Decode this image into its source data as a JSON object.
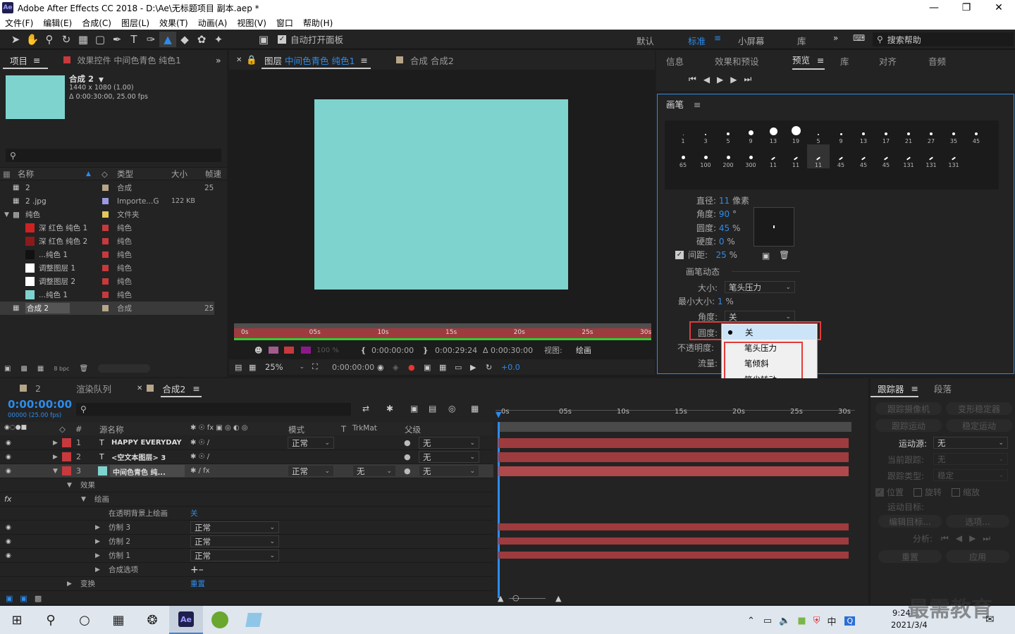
{
  "window": {
    "title": "Adobe After Effects CC 2018 - D:\\Ae\\无标题项目 副本.aep *",
    "app_badge": "Ae"
  },
  "menu": [
    "文件(F)",
    "编辑(E)",
    "合成(C)",
    "图层(L)",
    "效果(T)",
    "动画(A)",
    "视图(V)",
    "窗口",
    "帮助(H)"
  ],
  "toolbar": {
    "auto_open_label": "自动打开面板",
    "workspaces": [
      "默认",
      "标准",
      "小屏幕",
      "库"
    ],
    "active_workspace": "标准",
    "search_placeholder": "搜索帮助"
  },
  "project": {
    "tab_project": "项目",
    "tab_effects": "效果控件 中间色青色 纯色1",
    "comp_name": "合成 2",
    "comp_res": "1440 x 1080 (1.00)",
    "comp_dur": "Δ 0:00:30:00, 25.00 fps",
    "thumb_color": "#7fd3ce",
    "columns": [
      "名称",
      "类型",
      "大小",
      "帧速"
    ],
    "items": [
      {
        "name": "2",
        "color": "#b7a589",
        "type": "合成",
        "size": "",
        "fps": "25"
      },
      {
        "name": "2 .jpg",
        "color": "#9a9ae0",
        "type": "Importe...G",
        "size": "122 KB",
        "fps": ""
      },
      {
        "name": "纯色",
        "color": "#e4c55d",
        "type": "文件夹",
        "size": "",
        "fps": ""
      },
      {
        "name": "深 红色 纯色 1",
        "color": "#c8393d",
        "type": "纯色",
        "size": "",
        "fps": "",
        "swatch": "#cc2222"
      },
      {
        "name": "深 红色 纯色 2",
        "color": "#c8393d",
        "type": "纯色",
        "size": "",
        "fps": "",
        "swatch": "#8b1a1a"
      },
      {
        "name": "...纯色 1",
        "color": "#c8393d",
        "type": "纯色",
        "size": "",
        "fps": "",
        "swatch": "#111111"
      },
      {
        "name": "调整图层 1",
        "color": "#c8393d",
        "type": "纯色",
        "size": "",
        "fps": "",
        "swatch": "#ffffff"
      },
      {
        "name": "调整图层 2",
        "color": "#c8393d",
        "type": "纯色",
        "size": "",
        "fps": "",
        "swatch": "#ffffff"
      },
      {
        "name": "...纯色 1",
        "color": "#c8393d",
        "type": "纯色",
        "size": "",
        "fps": "",
        "swatch": "#7fd3ce"
      },
      {
        "name": "合成 2",
        "color": "#b7a589",
        "type": "合成",
        "size": "",
        "fps": "25"
      }
    ],
    "bpc": "8 bpc"
  },
  "viewer": {
    "tab_layer_prefix": "图层",
    "tab_layer_name": "中间色青色 纯色1",
    "tab_comp": "合成 合成2",
    "canvas_color": "#7fd3ce",
    "ruler_ticks": [
      "0s",
      "05s",
      "10s",
      "15s",
      "20s",
      "25s",
      "30s"
    ],
    "time_in": "0:00:00:00",
    "time_out": "0:00:29:24",
    "duration": "Δ 0:00:30:00",
    "view_label": "视图:",
    "view_value": "绘画",
    "zoom": "25%",
    "current_time": "0:00:00:00",
    "exposure": "+0.0",
    "opacity_pct": "100 %"
  },
  "right_tabs": [
    "信息",
    "效果和预设",
    "预览",
    "库",
    "对齐",
    "音频"
  ],
  "brush": {
    "title": "画笔",
    "row1": [
      "1",
      "3",
      "5",
      "9",
      "13",
      "19",
      "5",
      "9",
      "13",
      "17",
      "21",
      "27",
      "35",
      "45"
    ],
    "row2": [
      "65",
      "100",
      "200",
      "300",
      "11",
      "11",
      "11",
      "45",
      "45",
      "45",
      "131",
      "131",
      "131"
    ],
    "diameter_label": "直径:",
    "diameter_value": "11",
    "diameter_unit": "像素",
    "angle_label": "角度:",
    "angle_value": "90",
    "angle_unit": "°",
    "roundness_label": "圆度:",
    "roundness_value": "45",
    "roundness_unit": "%",
    "hardness_label": "硬度:",
    "hardness_value": "0",
    "hardness_unit": "%",
    "spacing_label": "间距:",
    "spacing_value": "25",
    "spacing_unit": "%",
    "dynamics_label": "画笔动态",
    "size_label": "大小:",
    "size_value": "笔头压力",
    "minsize_label": "最小大小:",
    "minsize_value": "1",
    "minsize_unit": "%",
    "angle2_label": "角度:",
    "angle2_value": "关",
    "roundness2_label": "圆度:",
    "opacity_label": "不透明度:",
    "flow_label": "流量:"
  },
  "dropdown": {
    "selected": "关",
    "options": [
      "笔头压力",
      "笔倾斜",
      "笔尖转动"
    ]
  },
  "timeline": {
    "tab_2": "2",
    "tab_render": "渲染队列",
    "tab_comp": "合成2",
    "timecode": "0:00:00:00",
    "timecode_sub": "00000 (25.00 fps)",
    "col_source": "源名称",
    "col_mode": "模式",
    "col_trkmat": "TrkMat",
    "col_parent": "父级",
    "ruler": [
      "0s",
      "05s",
      "10s",
      "15s",
      "20s",
      "25s",
      "30s"
    ],
    "layers": [
      {
        "num": "1",
        "type": "T",
        "name": "HAPPY EVERYDAY",
        "mode": "正常",
        "parent": "无"
      },
      {
        "num": "2",
        "type": "T",
        "name": "<空文本图层> 3",
        "mode": "正常",
        "parent": "无"
      },
      {
        "num": "3",
        "type": "",
        "name": "中间色青色 纯...",
        "mode": "正常",
        "parent": "无",
        "trkmat": "无"
      }
    ],
    "effects_label": "效果",
    "paint_label": "绘画",
    "paint_on_transparent": "在透明背景上绘画",
    "paint_on_transparent_value": "关",
    "clone3": "仿制 3",
    "clone2": "仿制 2",
    "clone1": "仿制 1",
    "clone_mode": "正常",
    "composite_options": "合成选项",
    "transform_label": "变换",
    "reset_label": "重置"
  },
  "tracker": {
    "tab_tracker": "跟踪器",
    "tab_paragraph": "段落",
    "track_camera": "跟踪摄像机",
    "warp_stabilize": "变形稳定器",
    "track_motion": "跟踪运动",
    "stabilize_motion": "稳定运动",
    "motion_source_label": "运动源:",
    "motion_source_value": "无",
    "current_track_label": "当前跟踪:",
    "current_track_value": "无",
    "track_type_label": "跟踪类型:",
    "track_type_value": "稳定",
    "position": "位置",
    "rotation": "旋转",
    "scale": "缩放",
    "motion_target_label": "运动目标:",
    "edit_target": "编辑目标...",
    "options": "选项...",
    "analyze_label": "分析:",
    "reset": "重置",
    "apply": "应用"
  },
  "taskbar": {
    "time": "9:24",
    "date": "2021/3/4",
    "ime": "中",
    "watermark": "最需教育"
  }
}
